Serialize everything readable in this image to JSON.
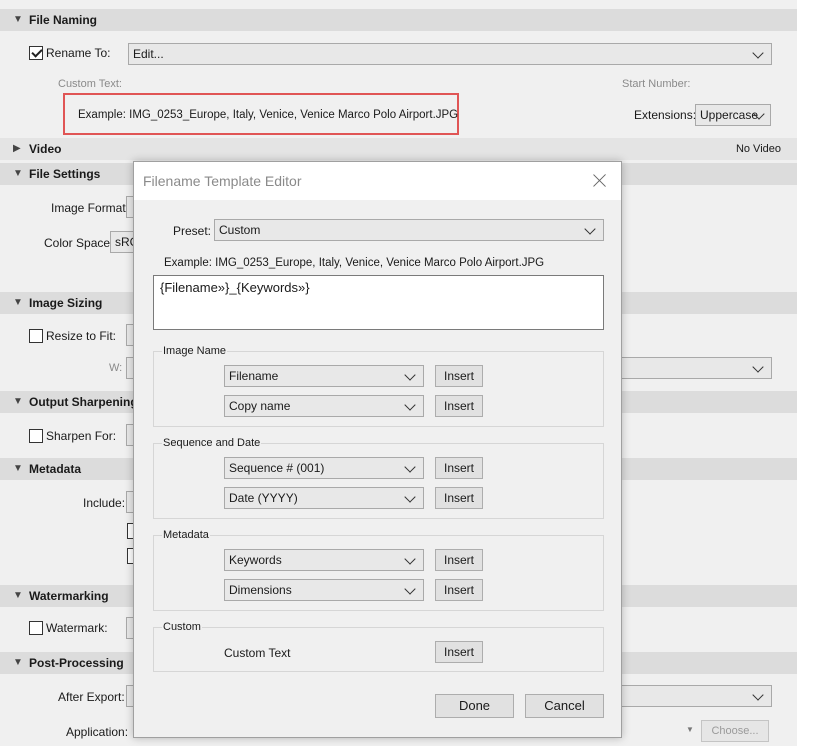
{
  "panel": {
    "file_naming": {
      "title": "File Naming",
      "rename_to_label": "Rename To:",
      "rename_to_checked": true,
      "rename_to_value": "Edit...",
      "custom_text_label": "Custom Text:",
      "start_number_label": "Start Number:",
      "example_text": "Example:  IMG_0253_Europe, Italy, Venice, Venice Marco Polo Airport.JPG",
      "extensions_label": "Extensions:",
      "extensions_value": "Uppercase"
    },
    "video": {
      "title": "Video",
      "status": "No Video"
    },
    "file_settings": {
      "title": "File Settings",
      "image_format_label": "Image Format:",
      "color_space_label": "Color Space:",
      "color_space_value": "sRG"
    },
    "image_sizing": {
      "title": "Image Sizing",
      "resize_label": "Resize to Fit:",
      "resize_checked": false,
      "w_label": "W:"
    },
    "output_sharpening": {
      "title": "Output Sharpening",
      "sharpen_label": "Sharpen For:",
      "sharpen_checked": false
    },
    "metadata": {
      "title": "Metadata",
      "include_label": "Include:"
    },
    "watermarking": {
      "title": "Watermarking",
      "watermark_label": "Watermark:",
      "watermark_checked": false
    },
    "post_processing": {
      "title": "Post-Processing",
      "after_export_label": "After Export:",
      "application_label": "Application:",
      "choose_button": "Choose..."
    }
  },
  "dialog": {
    "title": "Filename Template Editor",
    "preset_label": "Preset:",
    "preset_value": "Custom",
    "example_text": "Example:  IMG_0253_Europe, Italy, Venice, Venice Marco Polo Airport.JPG",
    "template_text": "{Filename»}_{Keywords»}",
    "groups": {
      "image_name": {
        "title": "Image Name",
        "rows": [
          {
            "value": "Filename",
            "button": "Insert"
          },
          {
            "value": "Copy name",
            "button": "Insert"
          }
        ]
      },
      "sequence_date": {
        "title": "Sequence and Date",
        "rows": [
          {
            "value": "Sequence # (001)",
            "button": "Insert"
          },
          {
            "value": "Date (YYYY)",
            "button": "Insert"
          }
        ]
      },
      "metadata": {
        "title": "Metadata",
        "rows": [
          {
            "value": "Keywords",
            "button": "Insert"
          },
          {
            "value": "Dimensions",
            "button": "Insert"
          }
        ]
      },
      "custom": {
        "title": "Custom",
        "label": "Custom Text",
        "button": "Insert"
      }
    },
    "done_button": "Done",
    "cancel_button": "Cancel"
  }
}
